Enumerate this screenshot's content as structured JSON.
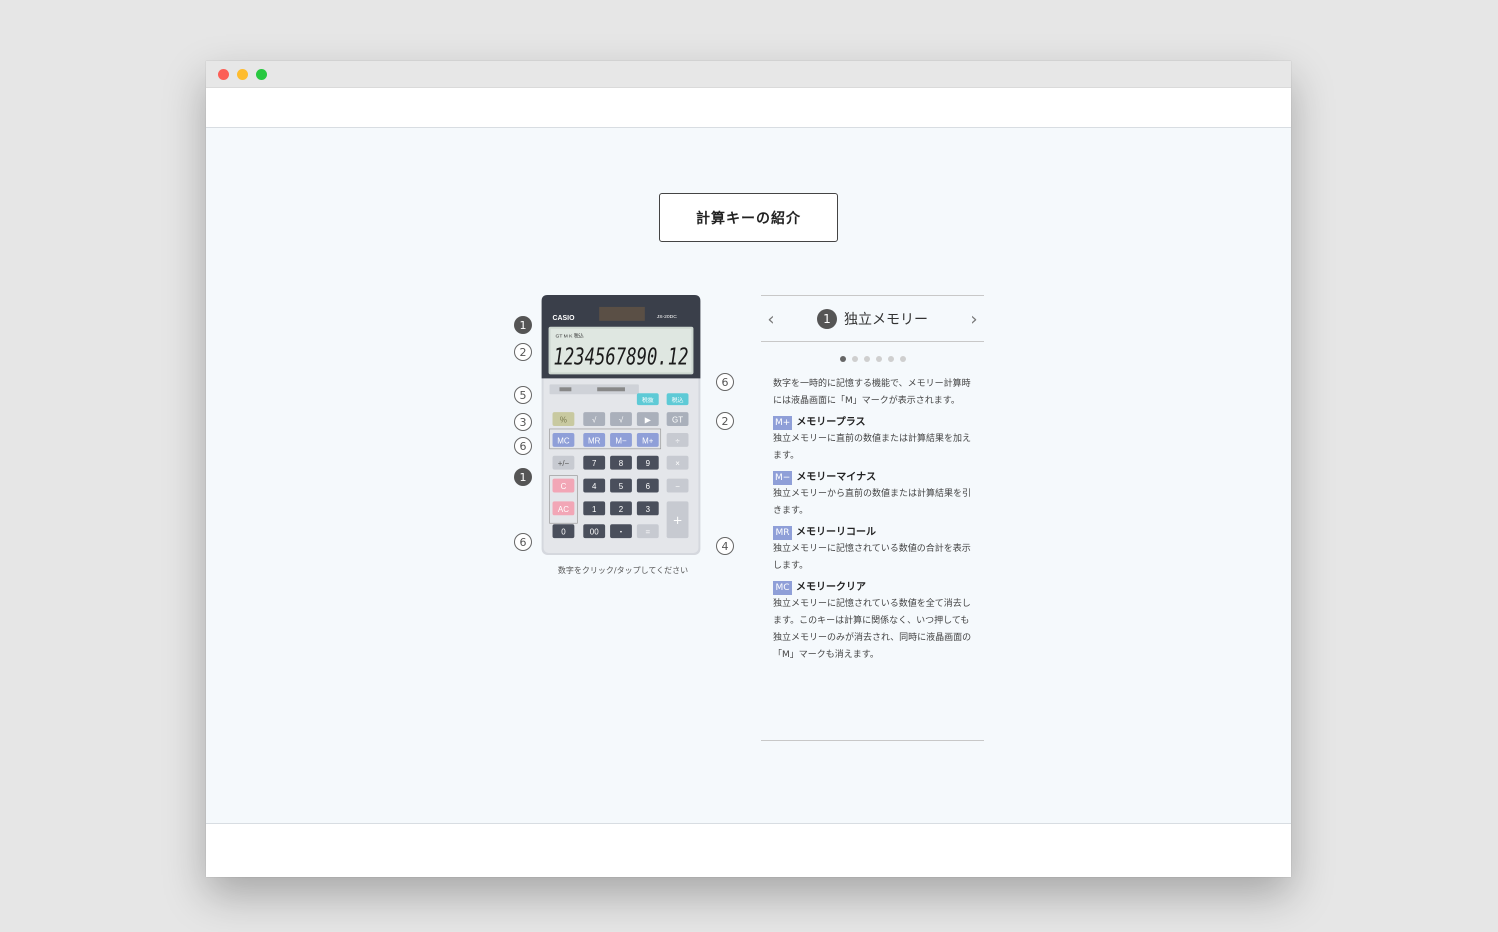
{
  "page": {
    "title_button": "計算キーの紹介",
    "hint": "数字をクリック/タップしてください"
  },
  "calculator": {
    "brand": "CASIO",
    "model": "JS-20DC",
    "display_digits": "1234567890.12",
    "display_indicators": "GT M  K  税込",
    "keys": {
      "mc": "MC",
      "mr": "MR",
      "mminus": "M−",
      "mplus": "M+",
      "divide": "÷",
      "sign": "+/−",
      "seven": "7",
      "eight": "8",
      "nine": "9",
      "times": "×",
      "clear": "C",
      "four": "4",
      "five": "5",
      "six": "6",
      "minus": "−",
      "allclear": "AC",
      "one": "1",
      "two": "2",
      "three": "3",
      "plus": "+",
      "zero": "0",
      "doublezero": "00",
      "dot": "・",
      "equals": "=",
      "sqrt": "√",
      "right": "▶",
      "gt": "GT",
      "percent": "%",
      "tax_out": "税抜",
      "tax_in": "税込"
    },
    "callouts": [
      "1",
      "2",
      "5",
      "3",
      "6",
      "1",
      "6",
      "6",
      "2",
      "4"
    ]
  },
  "panel": {
    "prev_icon": "chevron-left",
    "next_icon": "chevron-right",
    "head_number": "1",
    "head_title": "独立メモリー",
    "page_count": 6,
    "active_page": 1,
    "intro": "数字を一時的に記憶する機能で、メモリー計算時には液晶画面に「M」マークが表示されます。",
    "entries": [
      {
        "tag": "M+",
        "title": "メモリープラス",
        "text": "独立メモリーに直前の数値または計算結果を加えます。"
      },
      {
        "tag": "M−",
        "title": "メモリーマイナス",
        "text": "独立メモリーから直前の数値または計算結果を引きます。"
      },
      {
        "tag": "MR",
        "title": "メモリーリコール",
        "text": "独立メモリーに記憶されている数値の合計を表示します。"
      },
      {
        "tag": "MC",
        "title": "メモリークリア",
        "text": "独立メモリーに記憶されている数値を全て消去します。このキーは計算に関係なく、いつ押しても独立メモリーのみが消去され、同時に液晶画面の「M」マークも消えます。"
      }
    ]
  }
}
